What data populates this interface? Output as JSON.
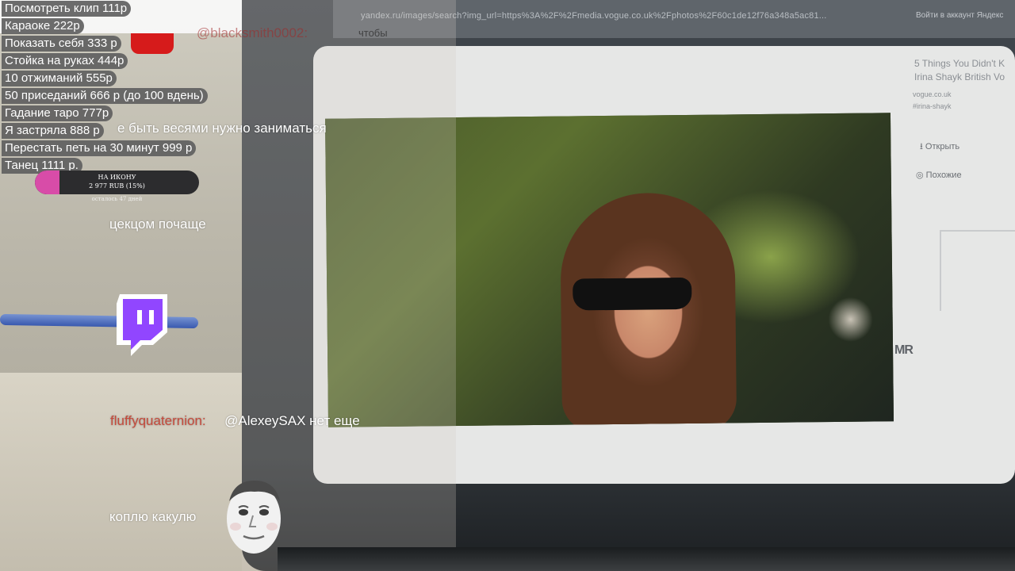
{
  "browser": {
    "url": "yandex.ru/images/search?img_url=https%3A%2F%2Fmedia.vogue.co.uk%2Fphotos%2F60c1de12f76a348a5ac81...",
    "right_text": "Войти в аккаунт  Яндекс"
  },
  "preview_panel": {
    "title_lines": [
      "5 Things You Didn't K",
      "Irina Shayk British Vo"
    ],
    "source": "vogue.co.uk",
    "tag": "#irina-shayk",
    "open_label": "Открыть",
    "similar_label": "Похожие",
    "brand_mark": "MR"
  },
  "reward_menu": [
    "Посмотреть клип 111р",
    "Караоке 222р",
    "Показать себя 333 р",
    "Стойка на руках 444р",
    "10 отжиманий 555р",
    "50 приседаний 666 р (до 100 вдень)",
    "Гадание таро 777р",
    "Я застряла 888 р",
    "Перестать петь на 30 минут 999 р",
    "Танец 1111 р."
  ],
  "ghost_chat": {
    "user": "@blacksmith0002:",
    "word": "чтобы",
    "behind_line": "е быть весями нужно заниматься"
  },
  "donation_goal": {
    "title": "НА ИКОНУ",
    "amount": "2 977 RUB (15%)",
    "progress": 0.15,
    "days_left": "осталось 47 дней"
  },
  "chat": [
    {
      "user": "",
      "message": "цекцом почаще"
    },
    {
      "user": "fluffyquaternion:",
      "message": "@AlexeySAX нет еще"
    },
    {
      "user": "",
      "message": "коплю какулю"
    }
  ],
  "colors": {
    "menu_bg": "#5f5f5f",
    "chat_username": "#c54a3c",
    "donation_fill": "#d84ca8",
    "twitch_purple": "#9146ff"
  },
  "icons": {
    "twitch": "twitch-glitch-icon",
    "avatar": "kappa-face-emote"
  }
}
